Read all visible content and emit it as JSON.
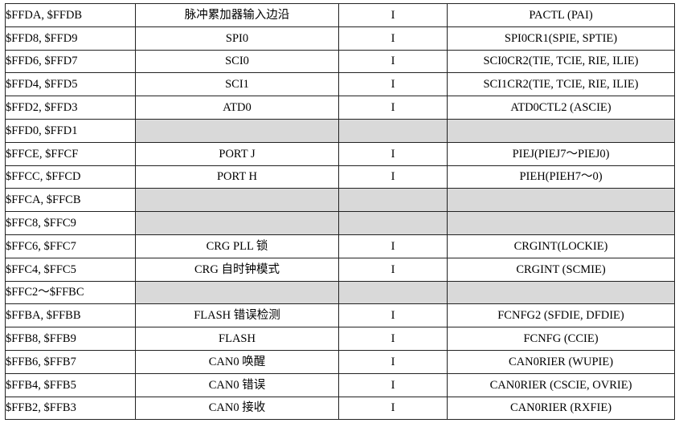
{
  "rows": [
    {
      "address": "$FFDA, $FFDB",
      "source": "脉冲累加器输入边沿",
      "ccr": "I",
      "enable": "PACTL (PAI)"
    },
    {
      "address": "$FFD8, $FFD9",
      "source": "SPI0",
      "ccr": "I",
      "enable": "SPI0CR1(SPIE, SPTIE)"
    },
    {
      "address": "$FFD6, $FFD7",
      "source": "SCI0",
      "ccr": "I",
      "enable": "SCI0CR2(TIE, TCIE, RIE, ILIE)"
    },
    {
      "address": "$FFD4, $FFD5",
      "source": "SCI1",
      "ccr": "I",
      "enable": "SCI1CR2(TIE, TCIE, RIE, ILIE)"
    },
    {
      "address": "$FFD2, $FFD3",
      "source": "ATD0",
      "ccr": "I",
      "enable": "ATD0CTL2 (ASCIE)"
    },
    {
      "address": "$FFD0, $FFD1",
      "source": "",
      "ccr": "",
      "enable": "",
      "reserved": true
    },
    {
      "address": "$FFCE, $FFCF",
      "source": "PORT J",
      "ccr": "I",
      "enable": "PIEJ(PIEJ7～PIEJ0)"
    },
    {
      "address": "$FFCC, $FFCD",
      "source": "PORT H",
      "ccr": "I",
      "enable": "PIEH(PIEH7～0)"
    },
    {
      "address": "$FFCA, $FFCB",
      "source": "",
      "ccr": "",
      "enable": "",
      "reserved": true
    },
    {
      "address": "$FFC8, $FFC9",
      "source": "",
      "ccr": "",
      "enable": "",
      "reserved": true
    },
    {
      "address": "$FFC6, $FFC7",
      "source": "CRG PLL  锁",
      "ccr": "I",
      "enable": "CRGINT(LOCKIE)"
    },
    {
      "address": "$FFC4, $FFC5",
      "source": "CRG  自时钟模式",
      "ccr": "I",
      "enable": "CRGINT (SCMIE)"
    },
    {
      "address": "$FFC2～$FFBC",
      "source": "",
      "ccr": "",
      "enable": "",
      "reserved": true
    },
    {
      "address": "$FFBA, $FFBB",
      "source": "FLASH 错误检测",
      "ccr": "I",
      "enable": "FCNFG2 (SFDIE, DFDIE)"
    },
    {
      "address": "$FFB8, $FFB9",
      "source": "FLASH",
      "ccr": "I",
      "enable": "FCNFG (CCIE)"
    },
    {
      "address": "$FFB6, $FFB7",
      "source": "CAN0  唤醒",
      "ccr": "I",
      "enable": "CAN0RIER (WUPIE)"
    },
    {
      "address": "$FFB4, $FFB5",
      "source": "CAN0  错误",
      "ccr": "I",
      "enable": "CAN0RIER (CSCIE, OVRIE)"
    },
    {
      "address": "$FFB2, $FFB3",
      "source": "CAN0  接收",
      "ccr": "I",
      "enable": "CAN0RIER (RXFIE)"
    }
  ],
  "colors": {
    "reserved_fill": "#d9d9d9",
    "border": "#222222"
  }
}
